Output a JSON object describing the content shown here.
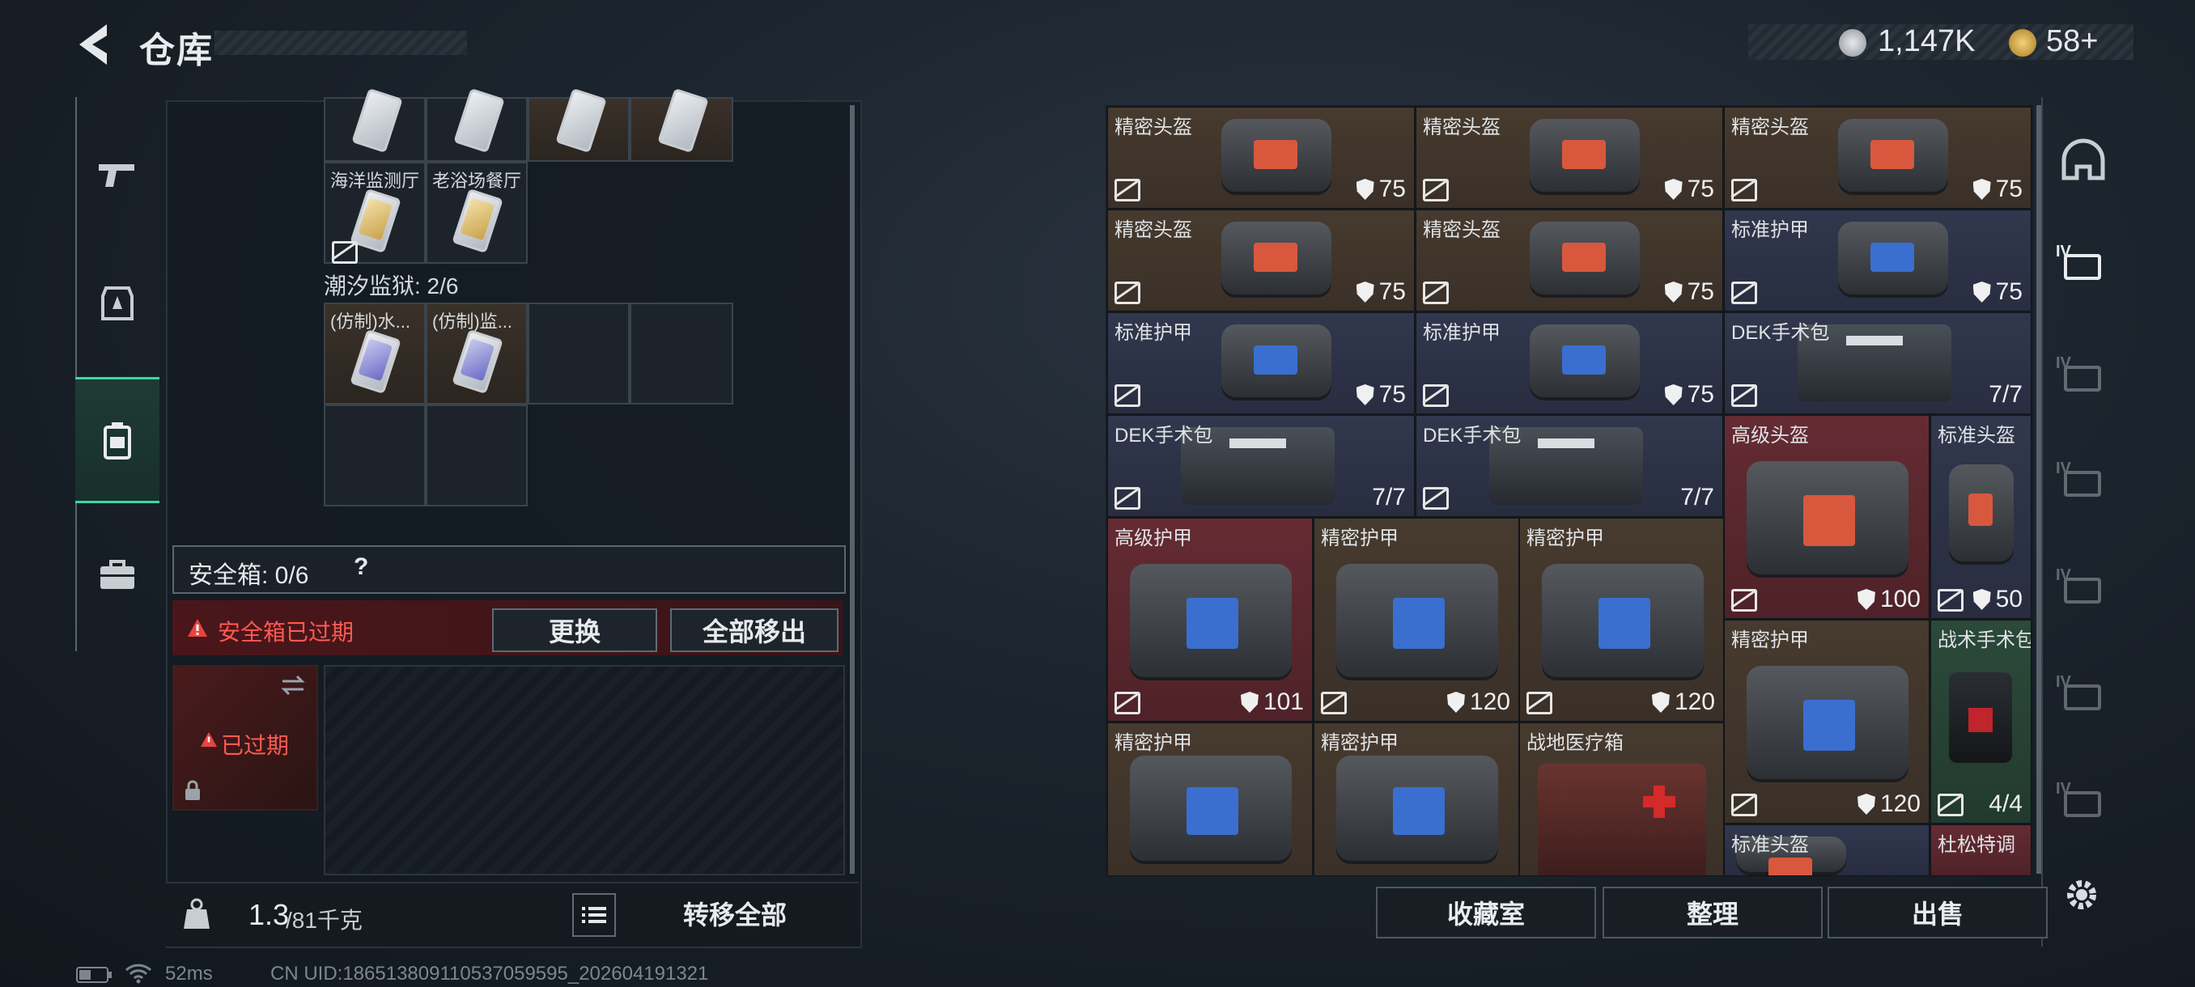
{
  "header": {
    "title": "仓库"
  },
  "currency": {
    "silver": "1,147K",
    "gold": "58+"
  },
  "left": {
    "row1_labels": [
      "海洋监测厅",
      "老浴场餐厅"
    ],
    "prison_count": "潮汐监狱: 2/6",
    "row2_labels": [
      "(仿制)水...",
      "(仿制)监..."
    ],
    "safe_box": "安全箱: 0/6",
    "help": "?",
    "expired_warning": "安全箱已过期",
    "replace_button": "更换",
    "move_all_out_button": "全部移出",
    "expired_badge": "已过期",
    "weight_value": "1.3",
    "weight_max": "/81千克",
    "transfer_all_button": "转移全部"
  },
  "items": [
    {
      "name": "精密头盔",
      "value": "75",
      "color": "brown"
    },
    {
      "name": "精密头盔",
      "value": "75",
      "color": "brown"
    },
    {
      "name": "精密头盔",
      "value": "75",
      "color": "brown"
    },
    {
      "name": "精密头盔",
      "value": "75",
      "color": "brown"
    },
    {
      "name": "精密头盔",
      "value": "75",
      "color": "brown"
    },
    {
      "name": "标准护甲",
      "value": "75",
      "color": "navy"
    },
    {
      "name": "标准护甲",
      "value": "75",
      "color": "navy"
    },
    {
      "name": "标准护甲",
      "value": "75",
      "color": "navy"
    },
    {
      "name": "DEK手术包",
      "value": "7/7",
      "color": "navy"
    },
    {
      "name": "DEK手术包",
      "value": "7/7",
      "color": "navy"
    },
    {
      "name": "DEK手术包",
      "value": "7/7",
      "color": "navy"
    },
    {
      "name": "高级头盔",
      "value": "100",
      "color": "red"
    },
    {
      "name": "标准头盔",
      "value": "50",
      "color": "navy"
    },
    {
      "name": "高级护甲",
      "value": "101",
      "color": "red"
    },
    {
      "name": "精密护甲",
      "value": "120",
      "color": "brown"
    },
    {
      "name": "精密护甲",
      "value": "120",
      "color": "brown"
    },
    {
      "name": "精密护甲",
      "value": "120",
      "color": "brown"
    },
    {
      "name": "战术手术包",
      "value": "4/4",
      "color": "green"
    },
    {
      "name": "精密护甲",
      "value": "",
      "color": "brown"
    },
    {
      "name": "精密护甲",
      "value": "",
      "color": "brown"
    },
    {
      "name": "战地医疗箱",
      "value": "",
      "color": "brown"
    },
    {
      "name": "标准头盔",
      "value": "",
      "color": "navy"
    },
    {
      "name": "杜松特调",
      "value": "",
      "color": "red"
    }
  ],
  "right_buttons": {
    "collection": "收藏室",
    "organize": "整理",
    "sell": "出售"
  },
  "side_labels": [
    "IV",
    "IV",
    "IV",
    "IV",
    "IV",
    "IV"
  ],
  "status": {
    "ping": "52ms",
    "uid": "CN UID:186513809110537059595_202604191321"
  },
  "colors": {
    "accent_green": "#37d9a2",
    "warning_red": "#e8443f",
    "item_brown": "#473a2e",
    "item_navy": "#31374d",
    "item_red": "#652b33"
  },
  "icons": [
    "back-arrow-icon",
    "silver-coin-icon",
    "gold-coin-icon",
    "gun-icon",
    "armor-tab-icon",
    "backpack-icon",
    "briefcase-icon",
    "no-insure-icon",
    "shield-icon",
    "warning-icon",
    "swap-icon",
    "lock-icon",
    "weight-icon",
    "list-icon",
    "helmet-slot-icon",
    "gear-icon",
    "wifi-icon",
    "battery-icon"
  ]
}
